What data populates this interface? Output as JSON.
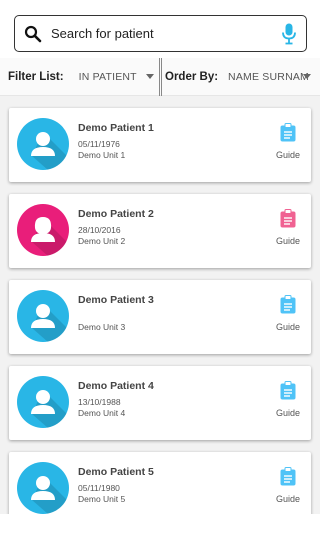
{
  "search": {
    "placeholder": "Search for patient"
  },
  "filter": {
    "list_label": "Filter List:",
    "list_value": "IN PATIENT",
    "order_label": "Order By:",
    "order_value": "NAME SURNAM"
  },
  "patients": [
    {
      "name": "Demo Patient 1",
      "dob": "05/11/1976",
      "unit": "Demo Unit 1",
      "avatar_color": "#29b6e6",
      "guide_color": "#4fc3f7",
      "guide_label": "Guide"
    },
    {
      "name": "Demo Patient 2",
      "dob": "28/10/2016",
      "unit": "Demo Unit 2",
      "avatar_color": "#e91e7a",
      "guide_color": "#f06292",
      "guide_label": "Guide"
    },
    {
      "name": "Demo Patient 3",
      "dob": "",
      "unit": "Demo Unit 3",
      "avatar_color": "#29b6e6",
      "guide_color": "#4fc3f7",
      "guide_label": "Guide"
    },
    {
      "name": "Demo Patient 4",
      "dob": "13/10/1988",
      "unit": "Demo Unit 4",
      "avatar_color": "#29b6e6",
      "guide_color": "#4fc3f7",
      "guide_label": "Guide"
    },
    {
      "name": "Demo Patient 5",
      "dob": "05/11/1980",
      "unit": "Demo Unit 5",
      "avatar_color": "#29b6e6",
      "guide_color": "#4fc3f7",
      "guide_label": "Guide"
    }
  ],
  "icons": {
    "search": "search-icon",
    "mic": "microphone-icon",
    "dropdown": "chevron-down-icon",
    "avatar": "person-icon",
    "guide": "clipboard-icon"
  },
  "colors": {
    "mic": "#29b6e6"
  }
}
